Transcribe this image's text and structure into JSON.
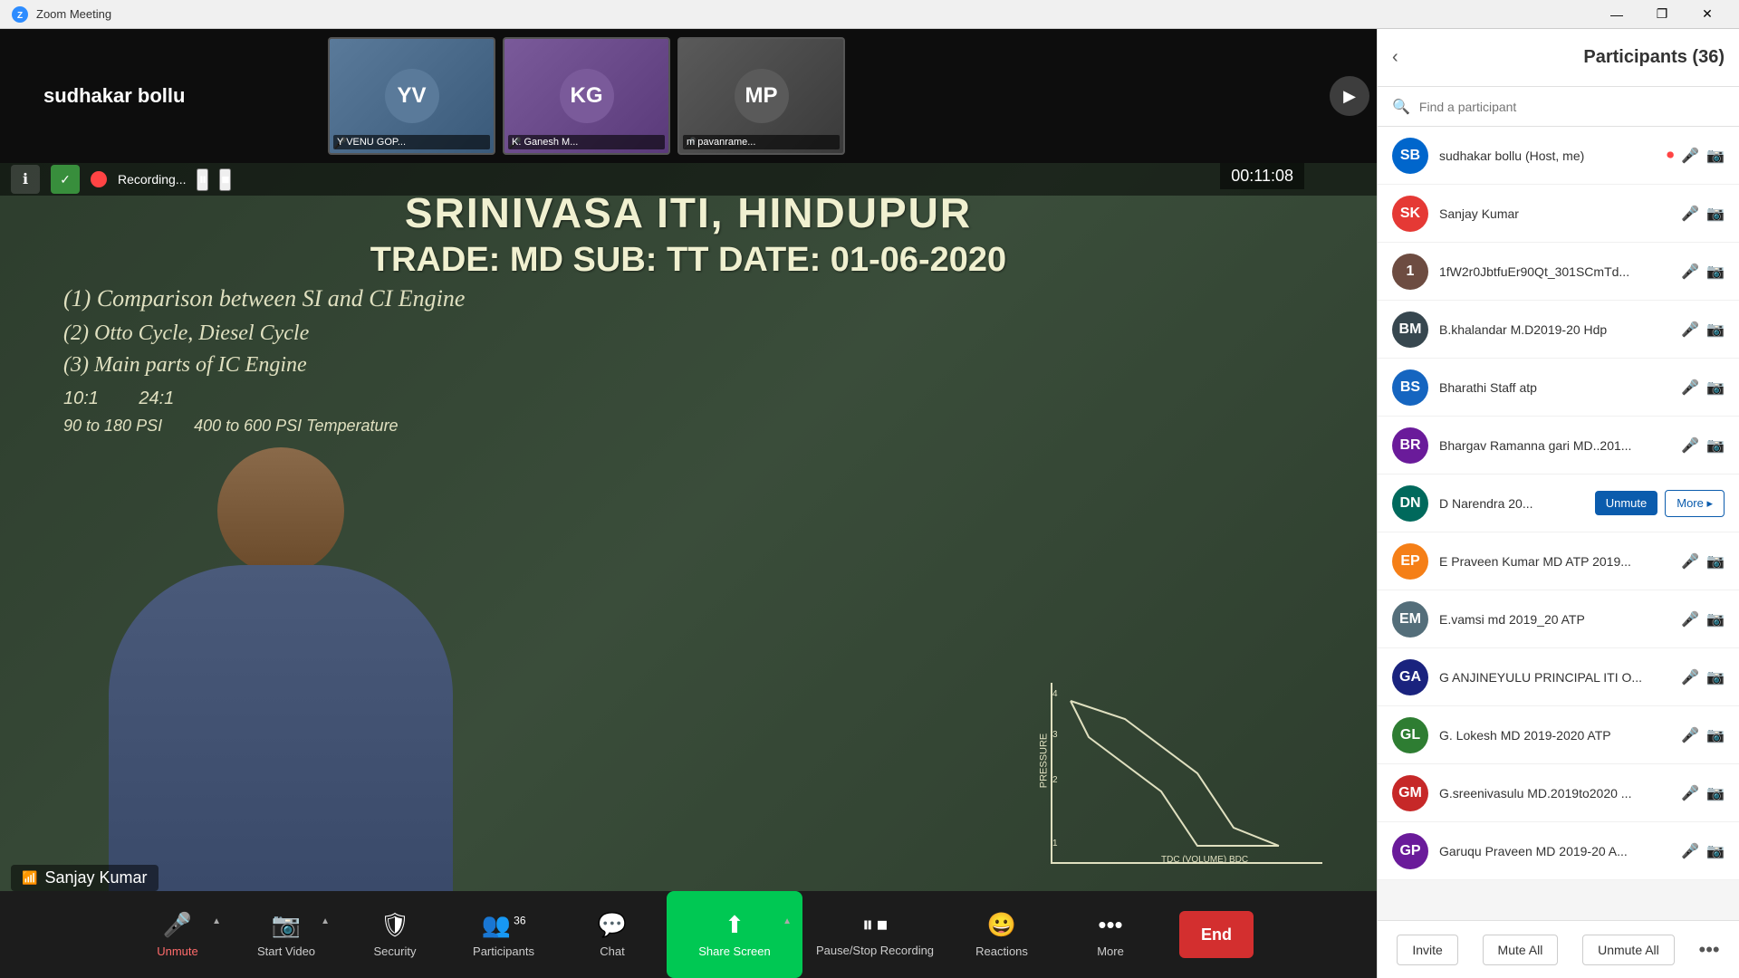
{
  "titleBar": {
    "appName": "Zoom Meeting",
    "minimize": "—",
    "maximize": "❐",
    "close": "✕"
  },
  "videoArea": {
    "hostLabel": "sudhakar bollu",
    "participants": [
      {
        "id": "p1",
        "name": "Y VENU GOP...",
        "bgColor": "#5a7a9a",
        "initials": "YV",
        "micMuted": true
      },
      {
        "id": "p2",
        "name": "K. Ganesh M...",
        "bgColor": "#7a5a9a",
        "initials": "KG",
        "micMuted": true
      },
      {
        "id": "p3",
        "name": "m pavanrame...",
        "bgColor": "#5a5a5a",
        "initials": "MP",
        "micMuted": true
      }
    ],
    "timer": "00:11:08",
    "recording": {
      "text": "Recording...",
      "pauseBtn": "⏸",
      "stopBtn": "⏹"
    },
    "bottomNameTag": "Sanjay Kumar",
    "chalkboard": {
      "line1": "SRINIVASA ITI, HINDUPUR",
      "line2": "TRADE: MD    SUB: TT    DATE: 01-06-2020",
      "topic1": "(1) Comparison between SI and CI Engine",
      "topic2": "(2) Otto Cycle, Diesel Cycle",
      "topic3": "(3) Main parts of IC Engine"
    }
  },
  "toolbar": {
    "micBtn": {
      "label": "Unmute",
      "icon": "🎤"
    },
    "videoBtn": {
      "label": "Start Video",
      "icon": "📷"
    },
    "securityBtn": {
      "label": "Security",
      "icon": "🛡"
    },
    "participantsBtn": {
      "label": "Participants",
      "icon": "👥",
      "count": "36"
    },
    "chatBtn": {
      "label": "Chat",
      "icon": "💬"
    },
    "shareBtn": {
      "label": "Share Screen",
      "icon": "⬆"
    },
    "pauseRecBtn": {
      "label": "Pause/Stop Recording",
      "icon1": "⏸",
      "icon2": "⏹"
    },
    "reactionsBtn": {
      "label": "Reactions",
      "icon": "😀"
    },
    "moreBtn": {
      "label": "More",
      "icon": "•••"
    },
    "endBtn": "End"
  },
  "rightPanel": {
    "title": "Participants (36)",
    "search": {
      "placeholder": "Find a participant"
    },
    "participants": [
      {
        "initials": "SB",
        "color": "#0066cc",
        "name": "sudhakar bollu (Host, me)",
        "hasMic": true,
        "micMuted": false,
        "hasVideo": true,
        "isRed": true
      },
      {
        "initials": "SK",
        "color": "#e53935",
        "name": "Sanjay Kumar",
        "hasMic": true,
        "micMuted": false,
        "hasVideo": true
      },
      {
        "initials": "1",
        "color": "#6d4c41",
        "name": "1fW2r0JbtfuEr90Qt_301SCmTd...",
        "hasMic": true,
        "micMuted": true,
        "hasVideo": true
      },
      {
        "initials": "BM",
        "color": "#37474f",
        "name": "B.khalandar  M.D2019-20 Hdp",
        "hasMic": true,
        "micMuted": true,
        "hasVideo": true
      },
      {
        "initials": "BS",
        "color": "#1565c0",
        "name": "Bharathi Staff atp",
        "hasMic": true,
        "micMuted": true,
        "hasVideo": true
      },
      {
        "initials": "BR",
        "color": "#6a1b9a",
        "name": "Bhargav Ramanna gari MD..201...",
        "hasMic": true,
        "micMuted": true,
        "hasVideo": true
      },
      {
        "initials": "DN",
        "color": "#00695c",
        "name": "D Narendra 20...",
        "hasUnmute": true,
        "hasMore": true,
        "unmuteBtnLabel": "Unmute",
        "moreBtnLabel": "More ▸"
      },
      {
        "initials": "EP",
        "color": "#f57f17",
        "name": "E Praveen Kumar MD ATP 2019...",
        "hasMic": true,
        "micMuted": true,
        "hasVideo": true
      },
      {
        "initials": "EM",
        "color": "#37474f",
        "name": "E.vamsi md 2019_20 ATP",
        "hasMic": true,
        "micMuted": true,
        "hasVideo": true
      },
      {
        "initials": "GA",
        "color": "#1a237e",
        "name": "G ANJINEYULU PRINCIPAL ITI O...",
        "hasMic": true,
        "micMuted": true,
        "hasVideo": true
      },
      {
        "initials": "GL",
        "color": "#1b5e20",
        "name": "G. Lokesh MD 2019-2020 ATP",
        "hasMic": true,
        "micMuted": true,
        "hasVideo": true
      },
      {
        "initials": "GM",
        "color": "#b71c1c",
        "name": "G.sreenivasulu MD.2019to2020 ...",
        "hasMic": true,
        "micMuted": true,
        "hasVideo": true
      },
      {
        "initials": "GP",
        "color": "#4a148c",
        "name": "Garuqu Praveen MD 2019-20 A...",
        "hasMic": true,
        "micMuted": true,
        "hasVideo": true
      }
    ],
    "footer": {
      "inviteBtn": "Invite",
      "muteAllBtn": "Mute All",
      "unmuteAllBtn": "Unmute All",
      "moreIcon": "•••"
    }
  },
  "avatarColors": {
    "SB": "#0066cc",
    "SK": "#e53935",
    "1": "#6d4c41",
    "BM": "#37474f",
    "BS": "#1565c0",
    "BR": "#6a1b9a",
    "DN": "#00695c",
    "EP": "#f57f17",
    "EM": "#546e7a",
    "GA": "#1a237e",
    "GL": "#2e7d32",
    "GM": "#c62828",
    "GP": "#6a1b9a"
  }
}
